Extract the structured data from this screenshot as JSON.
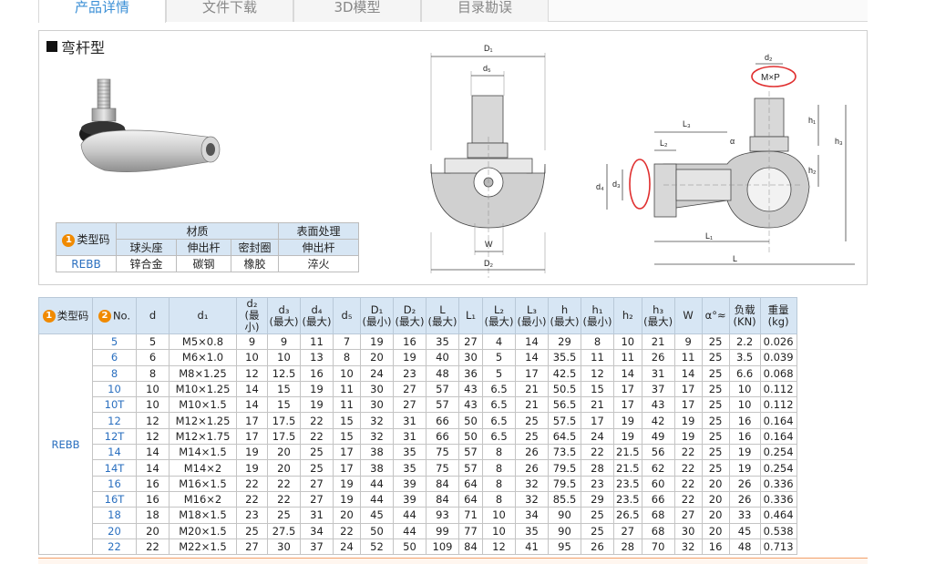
{
  "tabs": [
    "产品详情",
    "文件下载",
    "3D模型",
    "目录勘误"
  ],
  "section_title": "弯杆型",
  "material_table": {
    "type_code_label": "类型码",
    "material_label": "材质",
    "surface_label": "表面处理",
    "sub_headers": [
      "球头座",
      "伸出杆",
      "密封圈",
      "伸出杆"
    ],
    "row": [
      "REBB",
      "锌合金",
      "碳钢",
      "橡胶",
      "淬火"
    ]
  },
  "drawing_labels": {
    "D1": "D₁",
    "d5": "d₅",
    "W": "W",
    "D2": "D₂",
    "d2": "d₂",
    "MxP": "M×P",
    "L3": "L₃",
    "L2": "L₂",
    "alpha": "α",
    "h1": "h₁",
    "h3": "h₃",
    "h": "h",
    "h2": "h₂",
    "d4": "d₄",
    "d3": "d₃",
    "L1": "L₁",
    "L": "L"
  },
  "spec_table": {
    "headers": [
      {
        "badge": "1",
        "text": "类型码"
      },
      {
        "badge": "2",
        "text": "No."
      },
      {
        "text": "d"
      },
      {
        "text": "d₁"
      },
      {
        "text": "d₂\n(最小)"
      },
      {
        "text": "d₃\n(最大)"
      },
      {
        "text": "d₄\n(最大)"
      },
      {
        "text": "d₅"
      },
      {
        "text": "D₁\n(最小)"
      },
      {
        "text": "D₂\n(最大)"
      },
      {
        "text": "L\n(最大)"
      },
      {
        "text": "L₁"
      },
      {
        "text": "L₂\n(最大)"
      },
      {
        "text": "L₃\n(最小)"
      },
      {
        "text": "h\n(最大)"
      },
      {
        "text": "h₁\n(最小)"
      },
      {
        "text": "h₂"
      },
      {
        "text": "h₃\n(最大)"
      },
      {
        "text": "W"
      },
      {
        "text": "α°≈"
      },
      {
        "text": "负载\n(KN)"
      },
      {
        "text": "重量\n(kg)"
      }
    ],
    "group_code": "REBB",
    "rows": [
      [
        "5",
        "5",
        "M5×0.8",
        "9",
        "9",
        "11",
        "7",
        "19",
        "16",
        "35",
        "27",
        "4",
        "14",
        "29",
        "8",
        "10",
        "21",
        "9",
        "25",
        "2.2",
        "0.026"
      ],
      [
        "6",
        "6",
        "M6×1.0",
        "10",
        "10",
        "13",
        "8",
        "20",
        "19",
        "40",
        "30",
        "5",
        "14",
        "35.5",
        "11",
        "11",
        "26",
        "11",
        "25",
        "3.5",
        "0.039"
      ],
      [
        "8",
        "8",
        "M8×1.25",
        "12",
        "12.5",
        "16",
        "10",
        "24",
        "23",
        "48",
        "36",
        "5",
        "17",
        "42.5",
        "12",
        "14",
        "31",
        "14",
        "25",
        "6.6",
        "0.068"
      ],
      [
        "10",
        "10",
        "M10×1.25",
        "14",
        "15",
        "19",
        "11",
        "30",
        "27",
        "57",
        "43",
        "6.5",
        "21",
        "50.5",
        "15",
        "17",
        "37",
        "17",
        "25",
        "10",
        "0.112"
      ],
      [
        "10T",
        "10",
        "M10×1.5",
        "14",
        "15",
        "19",
        "11",
        "30",
        "27",
        "57",
        "43",
        "6.5",
        "21",
        "56.5",
        "21",
        "17",
        "43",
        "17",
        "25",
        "10",
        "0.112"
      ],
      [
        "12",
        "12",
        "M12×1.25",
        "17",
        "17.5",
        "22",
        "15",
        "32",
        "31",
        "66",
        "50",
        "6.5",
        "25",
        "57.5",
        "17",
        "19",
        "42",
        "19",
        "25",
        "16",
        "0.164"
      ],
      [
        "12T",
        "12",
        "M12×1.75",
        "17",
        "17.5",
        "22",
        "15",
        "32",
        "31",
        "66",
        "50",
        "6.5",
        "25",
        "64.5",
        "24",
        "19",
        "49",
        "19",
        "25",
        "16",
        "0.164"
      ],
      [
        "14",
        "14",
        "M14×1.5",
        "19",
        "20",
        "25",
        "17",
        "38",
        "35",
        "75",
        "57",
        "8",
        "26",
        "73.5",
        "22",
        "21.5",
        "56",
        "22",
        "25",
        "19",
        "0.254"
      ],
      [
        "14T",
        "14",
        "M14×2",
        "19",
        "20",
        "25",
        "17",
        "38",
        "35",
        "75",
        "57",
        "8",
        "26",
        "79.5",
        "28",
        "21.5",
        "62",
        "22",
        "25",
        "19",
        "0.254"
      ],
      [
        "16",
        "16",
        "M16×1.5",
        "22",
        "22",
        "27",
        "19",
        "44",
        "39",
        "84",
        "64",
        "8",
        "32",
        "79.5",
        "23",
        "23.5",
        "60",
        "22",
        "20",
        "26",
        "0.336"
      ],
      [
        "16T",
        "16",
        "M16×2",
        "22",
        "22",
        "27",
        "19",
        "44",
        "39",
        "84",
        "64",
        "8",
        "32",
        "85.5",
        "29",
        "23.5",
        "66",
        "22",
        "20",
        "26",
        "0.336"
      ],
      [
        "18",
        "18",
        "M18×1.5",
        "23",
        "25",
        "31",
        "20",
        "45",
        "44",
        "93",
        "71",
        "10",
        "34",
        "90",
        "25",
        "26.5",
        "68",
        "27",
        "20",
        "33",
        "0.464"
      ],
      [
        "20",
        "20",
        "M20×1.5",
        "25",
        "27.5",
        "34",
        "22",
        "50",
        "44",
        "99",
        "77",
        "10",
        "35",
        "90",
        "25",
        "27",
        "68",
        "30",
        "20",
        "45",
        "0.538"
      ],
      [
        "22",
        "22",
        "M22×1.5",
        "27",
        "30",
        "37",
        "24",
        "52",
        "50",
        "109",
        "84",
        "12",
        "41",
        "95",
        "26",
        "28",
        "70",
        "32",
        "16",
        "48",
        "0.713"
      ]
    ]
  },
  "colors": {
    "accent": "#3b8fd6",
    "header_bg": "#d7e6f4",
    "badge": "#f08a00",
    "code_blue": "#2a6fbf"
  }
}
